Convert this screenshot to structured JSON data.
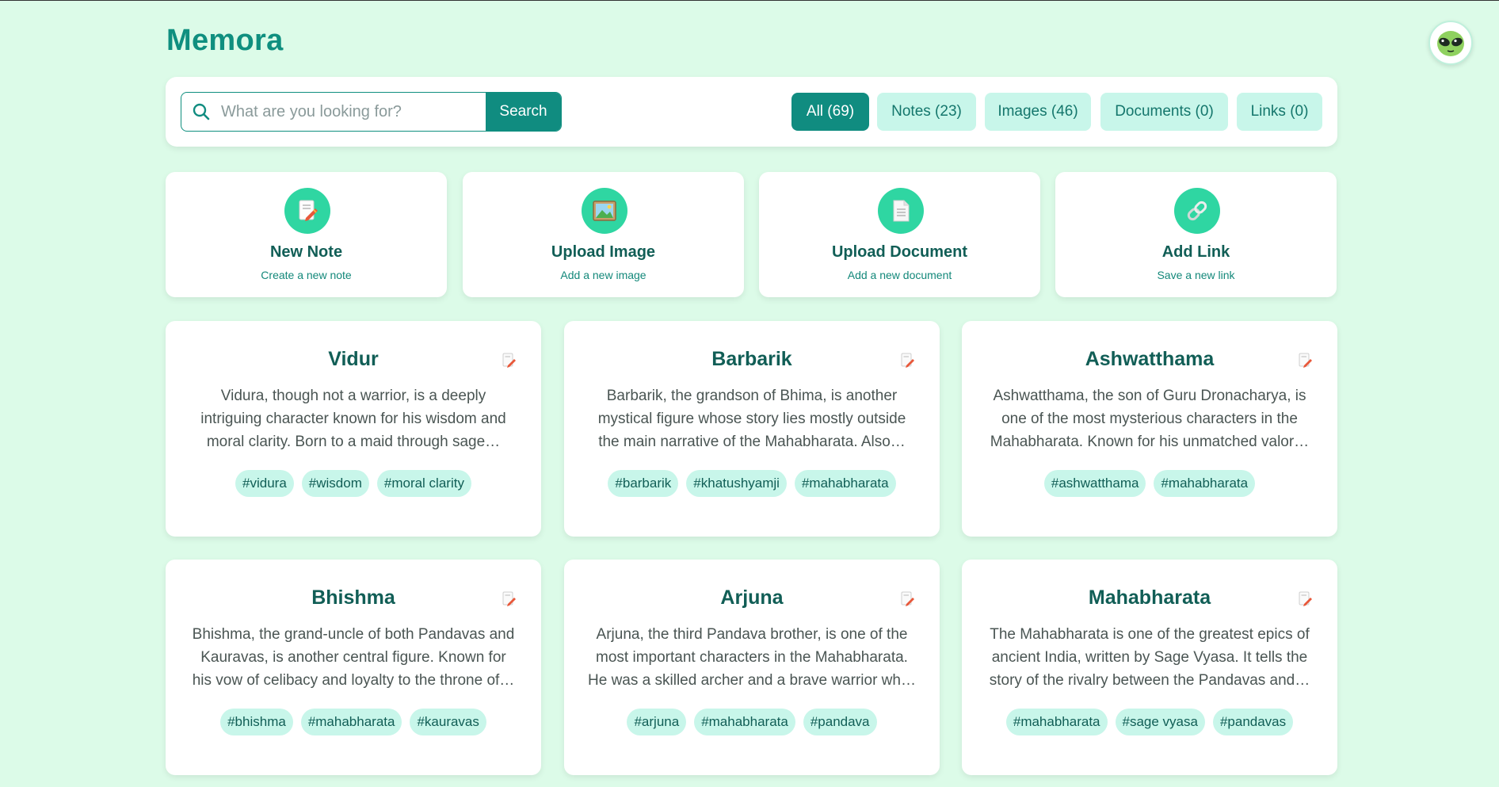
{
  "app": {
    "title": "Memora"
  },
  "search": {
    "placeholder": "What are you looking for?",
    "button_label": "Search"
  },
  "filters": [
    {
      "label": "All (69)",
      "active": true
    },
    {
      "label": "Notes (23)",
      "active": false
    },
    {
      "label": "Images (46)",
      "active": false
    },
    {
      "label": "Documents (0)",
      "active": false
    },
    {
      "label": "Links (0)",
      "active": false
    }
  ],
  "actions": [
    {
      "title": "New Note",
      "subtitle": "Create a new note",
      "icon": "memo-icon"
    },
    {
      "title": "Upload Image",
      "subtitle": "Add a new image",
      "icon": "image-icon"
    },
    {
      "title": "Upload Document",
      "subtitle": "Add a new document",
      "icon": "document-icon"
    },
    {
      "title": "Add Link",
      "subtitle": "Save a new link",
      "icon": "link-icon"
    }
  ],
  "notes": [
    {
      "title": "Vidur",
      "body": "Vidura, though not a warrior, is a deeply intriguing character known for his wisdom and moral clarity. Born to a maid through sage…",
      "tags": [
        "#vidura",
        "#wisdom",
        "#moral clarity"
      ]
    },
    {
      "title": "Barbarik",
      "body": "Barbarik, the grandson of Bhima, is another mystical figure whose story lies mostly outside the main narrative of the Mahabharata. Also…",
      "tags": [
        "#barbarik",
        "#khatushyamji",
        "#mahabharata"
      ]
    },
    {
      "title": "Ashwatthama",
      "body": "Ashwatthama, the son of Guru Dronacharya, is one of the most mysterious characters in the Mahabharata. Known for his unmatched valor…",
      "tags": [
        "#ashwatthama",
        "#mahabharata"
      ]
    },
    {
      "title": "Bhishma",
      "body": "Bhishma, the grand-uncle of both Pandavas and Kauravas, is another central figure. Known for his vow of celibacy and loyalty to the throne of…",
      "tags": [
        "#bhishma",
        "#mahabharata",
        "#kauravas"
      ]
    },
    {
      "title": "Arjuna",
      "body": "Arjuna, the third Pandava brother, is one of the most important characters in the Mahabharata. He was a skilled archer and a brave warrior wh…",
      "tags": [
        "#arjuna",
        "#mahabharata",
        "#pandava"
      ]
    },
    {
      "title": "Mahabharata",
      "body": "The Mahabharata is one of the greatest epics of ancient India, written by Sage Vyasa. It tells the story of the rivalry between the Pandavas and…",
      "tags": [
        "#mahabharata",
        "#sage vyasa",
        "#pandavas"
      ]
    }
  ],
  "colors": {
    "accent": "#108c80",
    "background": "#dcfbe8",
    "chip": "#c8f6ea",
    "icon_circle": "#2fd6a2"
  }
}
